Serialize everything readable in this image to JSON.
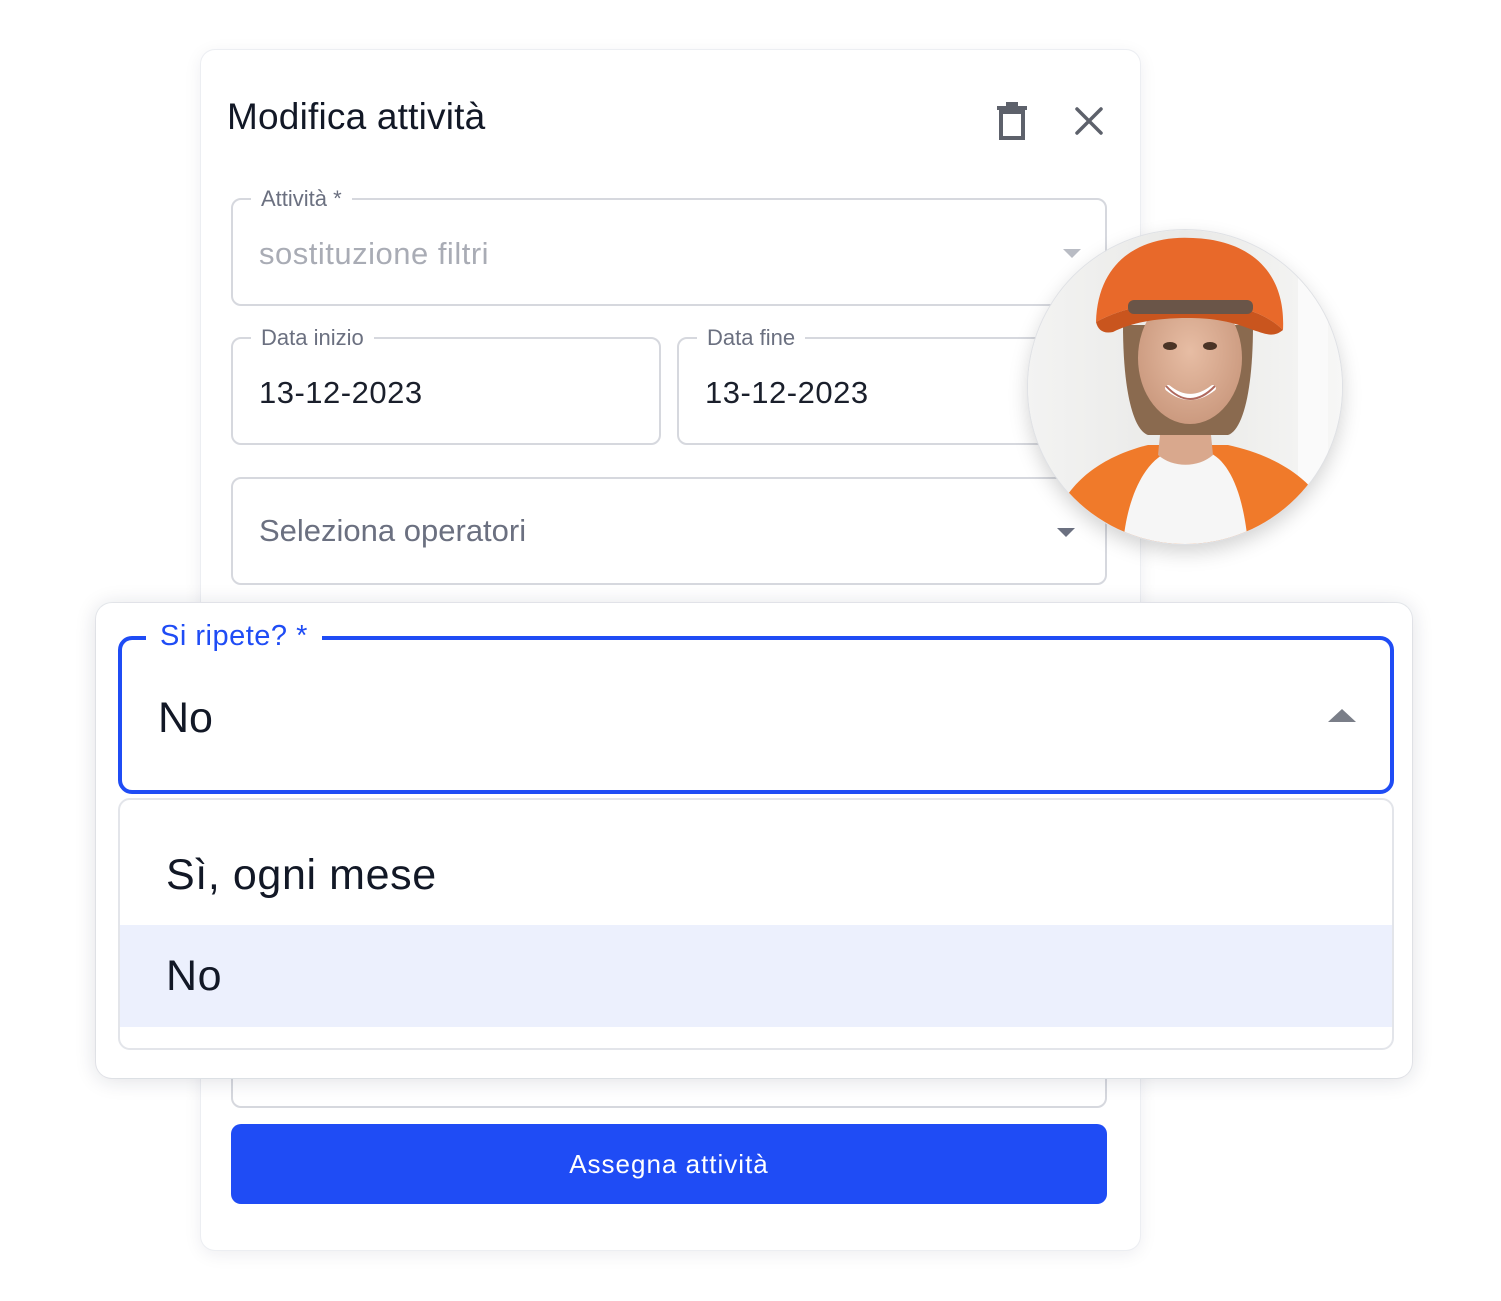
{
  "dialog": {
    "title": "Modifica attività",
    "fields": {
      "attivita": {
        "label": "Attività *",
        "value": "sostituzione filtri"
      },
      "data_inizio": {
        "label": "Data inizio",
        "value": "13-12-2023"
      },
      "data_fine": {
        "label": "Data fine",
        "value": "13-12-2023"
      },
      "operatori": {
        "placeholder": "Seleziona operatori"
      }
    },
    "assign_label": "Assegna attività"
  },
  "popup": {
    "select_label": "Si ripete? *",
    "selected_value": "No",
    "options": [
      "Sì, ogni mese",
      "No"
    ],
    "highlighted_option": "No"
  },
  "colors": {
    "accent": "#1f4cf5",
    "highlight": "#ecf0fd",
    "text": "#121826",
    "muted": "#6b7080"
  },
  "icons": [
    "trash-icon",
    "close-icon",
    "chevron-down-icon",
    "chevron-up-icon"
  ]
}
